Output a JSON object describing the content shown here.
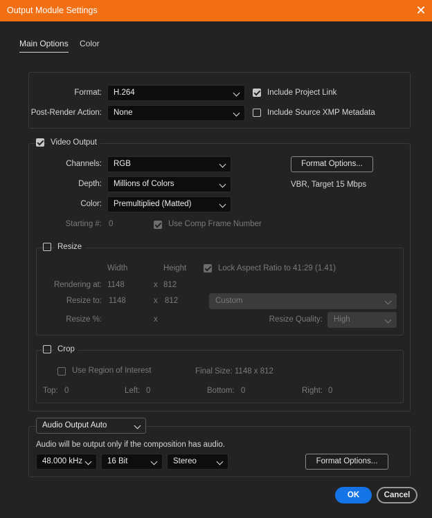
{
  "window": {
    "title": "Output Module Settings"
  },
  "tabs": [
    {
      "label": "Main Options",
      "active": true
    },
    {
      "label": "Color",
      "active": false
    }
  ],
  "format_section": {
    "format_label": "Format:",
    "format_value": "H.264",
    "post_render_label": "Post-Render Action:",
    "post_render_value": "None",
    "include_project_link": {
      "label": "Include Project Link",
      "checked": true
    },
    "include_xmp": {
      "label": "Include Source XMP Metadata",
      "checked": false
    }
  },
  "video_output": {
    "label": "Video Output",
    "checked": true,
    "channels_label": "Channels:",
    "channels_value": "RGB",
    "depth_label": "Depth:",
    "depth_value": "Millions of Colors",
    "color_label": "Color:",
    "color_value": "Premultiplied (Matted)",
    "format_options_label": "Format Options...",
    "format_summary": "VBR, Target 15 Mbps",
    "starting_label": "Starting #:",
    "starting_value": "0",
    "use_comp_frame": {
      "label": "Use Comp Frame Number",
      "checked": true
    }
  },
  "resize": {
    "label": "Resize",
    "checked": false,
    "width_header": "Width",
    "height_header": "Height",
    "lock_aspect": {
      "label": "Lock Aspect Ratio to 41:29 (1.41)",
      "checked": true
    },
    "rendering_at_label": "Rendering at:",
    "rendering_w": "1148",
    "rendering_x": "x",
    "rendering_h": "812",
    "resize_to_label": "Resize to:",
    "resize_w": "1148",
    "resize_x": "x",
    "resize_h": "812",
    "preset_value": "Custom",
    "resize_pct_label": "Resize %:",
    "resize_pct_x": "x",
    "quality_label": "Resize Quality:",
    "quality_value": "High"
  },
  "crop": {
    "label": "Crop",
    "checked": false,
    "roi": {
      "label": "Use Region of Interest",
      "checked": false
    },
    "final_size": "Final Size: 1148 x 812",
    "top_label": "Top:",
    "top_value": "0",
    "left_label": "Left:",
    "left_value": "0",
    "bottom_label": "Bottom:",
    "bottom_value": "0",
    "right_label": "Right:",
    "right_value": "0"
  },
  "audio": {
    "mode_value": "Audio Output Auto",
    "note": "Audio will be output only if the composition has audio.",
    "rate_value": "48.000 kHz",
    "bits_value": "16 Bit",
    "channels_value": "Stereo",
    "format_options_label": "Format Options..."
  },
  "footer": {
    "ok_label": "OK",
    "cancel_label": "Cancel"
  },
  "colors": {
    "accent": "#f36f14",
    "primary_button": "#1473e6",
    "background": "#232323"
  }
}
